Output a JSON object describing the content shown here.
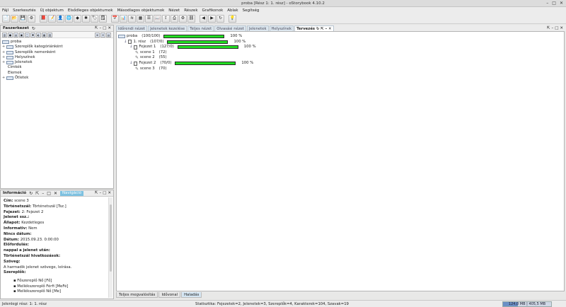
{
  "window": {
    "title": "proba [Rész 1: 1. rész] - oStorybook 4.10.2"
  },
  "menu": [
    "Fájl",
    "Szerkesztés",
    "Új objektum",
    "Elsődleges objektumok",
    "Másodlagos objektumok",
    "Nézet",
    "Részek",
    "Grafikonok",
    "Ablak",
    "Segítség"
  ],
  "toolbar_icons": [
    "new-file-icon",
    "open-folder-icon",
    "save-icon",
    "settings-icon",
    "chapter-icon",
    "scene-icon",
    "person-icon",
    "location-icon",
    "item-icon",
    "idea-icon",
    "tag-icon",
    "memo-icon",
    "calendar-icon",
    "chart-icon",
    "strand-icon",
    "table-icon",
    "list-icon",
    "book-icon",
    "export-icon",
    "print-icon",
    "gear-icon",
    "link-icon",
    "prev-part-icon",
    "next-part-icon",
    "refresh-icon",
    "lightbulb-icon"
  ],
  "tree_panel": {
    "title": "Faszerkezet",
    "items": [
      {
        "label": "proba",
        "level": 0,
        "type": "root"
      },
      {
        "label": "Szereplők kategóriánként",
        "level": 1,
        "type": "folder",
        "expander": "+"
      },
      {
        "label": "Szereplők nemenként",
        "level": 1,
        "type": "folder",
        "expander": "+"
      },
      {
        "label": "Helyszínek",
        "level": 1,
        "type": "folder",
        "expander": "+"
      },
      {
        "label": "Jelenetek",
        "level": 1,
        "type": "folder",
        "expander": "+"
      },
      {
        "label": "Címkék",
        "level": 1,
        "type": "plain",
        "expander": ""
      },
      {
        "label": "Elemek",
        "level": 1,
        "type": "plain",
        "expander": ""
      },
      {
        "label": "Ötletek",
        "level": 1,
        "type": "folder",
        "expander": "+"
      }
    ]
  },
  "info_panel": {
    "title": "Információ",
    "nav_tab": "Navigáció",
    "rows": [
      {
        "key": "Cím",
        "value": "scene 3"
      },
      {
        "key": "Történetszál",
        "value": "Történetszál [Tsz.]"
      },
      {
        "key": "Fejezet",
        "value": "2: Fejezet 2"
      },
      {
        "key": "Jelenet ssz.",
        "value": ""
      },
      {
        "key": "Állapot",
        "value": "Kezdetleges"
      },
      {
        "key": "Informativ",
        "value": "Nem"
      },
      {
        "key": "Nincs dátum",
        "value": ""
      },
      {
        "key": "Dátum",
        "value": "2015.09.23. 0:00:00"
      },
      {
        "key": "Előfordulás",
        "value": ""
      },
      {
        "key": "nappal a jelenet után",
        "value": ""
      },
      {
        "key": "Történetszál hivatkozások",
        "value": ""
      },
      {
        "key": "Szöveg",
        "value": ""
      }
    ],
    "text": "A harmadik jelenet szövege, leírása.",
    "characters_label": "Szereplők",
    "characters": [
      "Főszereplő Nő [Fő]",
      "Mellékszereplő Férfi [MeFé]",
      "Mellékszereplő Nő [Me]"
    ]
  },
  "tabs": [
    "Időrendi nézet",
    "Jelenetek kezelése",
    "Teljes nézet",
    "Olvasási nézet",
    "Jelenetek",
    "Helyszínek",
    "Tervezés"
  ],
  "active_tab": "Tervezés",
  "outline": [
    {
      "label": "proba",
      "count": "(100/100)",
      "level": 0,
      "progress": 100,
      "pct": "100 %",
      "icon": "book"
    },
    {
      "label": "1. rész",
      "count": "(107/0)",
      "level": 1,
      "progress": 100,
      "pct": "100 %",
      "icon": "part"
    },
    {
      "label": "Fejezet 1",
      "count": "(127/0)",
      "level": 2,
      "progress": 100,
      "pct": "100 %",
      "icon": "chapter"
    },
    {
      "label": "scene 1",
      "count": "(72)",
      "level": 3,
      "progress": null,
      "pct": "",
      "icon": "scene"
    },
    {
      "label": "scene 2",
      "count": "(55)",
      "level": 3,
      "progress": null,
      "pct": "",
      "icon": "scene"
    },
    {
      "label": "Fejezet 2",
      "count": "(70/0)",
      "level": 2,
      "progress": 100,
      "pct": "100 %",
      "icon": "chapter"
    },
    {
      "label": "scene 3",
      "count": "(70)",
      "level": 3,
      "progress": null,
      "pct": "",
      "icon": "scene"
    }
  ],
  "bottom_tabs": [
    "Teljes megvalósítás",
    "Idővonal",
    "Haladás"
  ],
  "active_bottom_tab": "Haladás",
  "status": {
    "left": "Jelenlegi rész: 1: 1. rész",
    "stats": "Statisztika: Fejezetek=2,  Jelenetek=3,  Szereplők=4,  Karakterek=104,  Szavak=19",
    "memory_used": "124,0 MB",
    "memory_total": "405,5 MB",
    "memory_fraction": 0.31
  },
  "colors": {
    "progress": "#22dd22",
    "nav_tab": "#7ec1e0",
    "memory": "#6b8fc5"
  }
}
